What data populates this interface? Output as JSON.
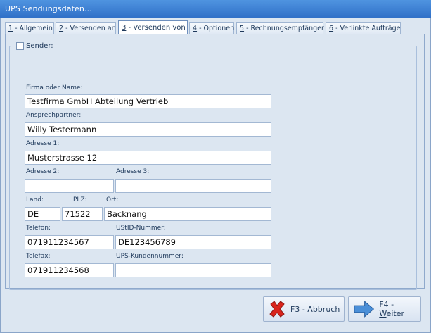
{
  "window": {
    "title": "UPS Sendungsdaten..."
  },
  "tabs": [
    {
      "key": "1",
      "label": " - Allgemein"
    },
    {
      "key": "2",
      "label": " - Versenden an"
    },
    {
      "key": "3",
      "label": " - Versenden von"
    },
    {
      "key": "4",
      "label": " - Optionen"
    },
    {
      "key": "5",
      "label": " - Rechnungsempfänger"
    },
    {
      "key": "6",
      "label": " - Verlinkte Aufträge"
    }
  ],
  "sender": {
    "group_label": "Sender:",
    "checked": false,
    "company": {
      "label": "Firma oder Name:",
      "value": "Testfirma GmbH Abteilung Vertrieb"
    },
    "contact": {
      "label": "Ansprechpartner:",
      "value": "Willy Testermann"
    },
    "address1": {
      "label": "Adresse 1:",
      "value": "Musterstrasse 12"
    },
    "address2": {
      "label": "Adresse 2:",
      "value": ""
    },
    "address3": {
      "label": "Adresse 3:",
      "value": ""
    },
    "country": {
      "label": "Land:",
      "value": "DE"
    },
    "zip": {
      "label": "PLZ:",
      "value": "71522"
    },
    "city": {
      "label": "Ort:",
      "value": "Backnang"
    },
    "phone": {
      "label": "Telefon:",
      "value": "071911234567"
    },
    "vat": {
      "label": "UStID-Nummer:",
      "value": "DE123456789"
    },
    "fax": {
      "label": "Telefax:",
      "value": "071911234568"
    },
    "ups_customer": {
      "label": "UPS-Kundennummer:",
      "value": ""
    }
  },
  "buttons": {
    "cancel": {
      "prefix": "F3 - ",
      "hotkey": "A",
      "rest": "bbruch",
      "icon": "red-x-icon"
    },
    "next": {
      "prefix": "F4 - ",
      "hotkey": "W",
      "rest": "eiter",
      "icon": "blue-arrow-right-icon"
    }
  },
  "colors": {
    "titlebar": "#2f6fc7",
    "background": "#dce6f1",
    "cancel_icon": "#d9241c",
    "next_icon": "#4a8fd8"
  }
}
